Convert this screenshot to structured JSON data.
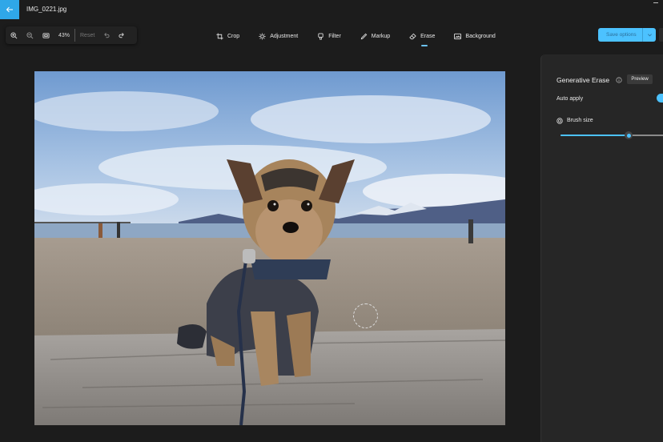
{
  "window": {
    "title": "IMG_0221.jpg"
  },
  "zoom_bar": {
    "zoom_level": "43%",
    "reset_label": "Reset"
  },
  "toolbar": {
    "tools": [
      {
        "label": "Crop",
        "icon": "crop-icon"
      },
      {
        "label": "Adjustment",
        "icon": "sun-icon"
      },
      {
        "label": "Filter",
        "icon": "filter-icon"
      },
      {
        "label": "Markup",
        "icon": "pen-icon"
      },
      {
        "label": "Erase",
        "icon": "eraser-icon",
        "active": true
      },
      {
        "label": "Background",
        "icon": "background-icon"
      }
    ],
    "save_label": "Save options"
  },
  "panel": {
    "title": "Generative Erase",
    "preview_badge": "Preview",
    "auto_apply_label": "Auto apply",
    "auto_apply_on": true,
    "brush_size_label": "Brush size",
    "brush_size_fraction": 0.66
  },
  "colors": {
    "accent": "#4cc2ff",
    "background": "#1c1c1c",
    "panel": "#262626"
  }
}
